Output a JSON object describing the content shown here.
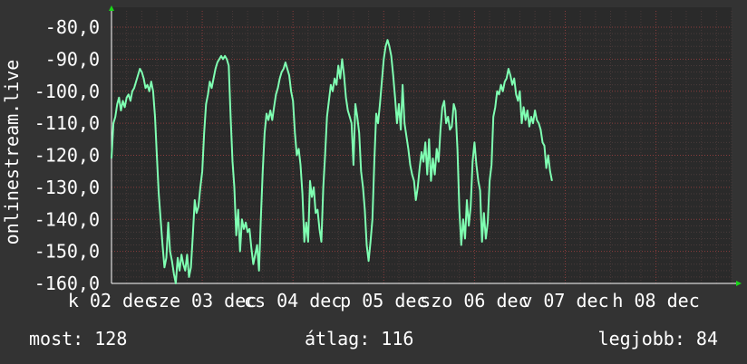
{
  "chart_data": {
    "type": "line",
    "ylabel": "onlinestream.live",
    "ylim": [
      -160,
      -80
    ],
    "yticks": [
      "-80,0",
      "-90,0",
      "-100,0",
      "-110,0",
      "-120,0",
      "-130,0",
      "-140,0",
      "-150,0",
      "-160,0"
    ],
    "x_range_hours": [
      0,
      164
    ],
    "xticks": [
      {
        "label": "k 02 dec",
        "x": 0
      },
      {
        "label": "sze 03 dec",
        "x": 24
      },
      {
        "label": "cs 04 dec",
        "x": 48
      },
      {
        "label": "p 05 dec",
        "x": 72
      },
      {
        "label": "szo 06 dec",
        "x": 96
      },
      {
        "label": "v 07 dec",
        "x": 120
      },
      {
        "label": "h 08 dec",
        "x": 144
      }
    ],
    "grid": true,
    "line_color": "#7fffb2",
    "series": [
      {
        "values": [
          [
            0,
            -121
          ],
          [
            0.5,
            -110
          ],
          [
            1,
            -108
          ],
          [
            1.5,
            -104
          ],
          [
            2,
            -102
          ],
          [
            2.5,
            -106
          ],
          [
            3,
            -103
          ],
          [
            3.5,
            -105
          ],
          [
            4,
            -102
          ],
          [
            4.5,
            -101
          ],
          [
            5,
            -103
          ],
          [
            5.5,
            -100
          ],
          [
            6,
            -99
          ],
          [
            6.5,
            -97
          ],
          [
            7,
            -95
          ],
          [
            7.5,
            -93
          ],
          [
            8,
            -94
          ],
          [
            8.5,
            -96
          ],
          [
            9,
            -99
          ],
          [
            9.5,
            -98
          ],
          [
            10,
            -100
          ],
          [
            10.5,
            -97
          ],
          [
            11,
            -100
          ],
          [
            11.5,
            -108
          ],
          [
            12,
            -120
          ],
          [
            12.5,
            -132
          ],
          [
            13,
            -140
          ],
          [
            13.5,
            -148
          ],
          [
            14,
            -155
          ],
          [
            14.5,
            -152
          ],
          [
            15,
            -141
          ],
          [
            15.5,
            -150
          ],
          [
            16,
            -153
          ],
          [
            16.5,
            -157
          ],
          [
            17,
            -160
          ],
          [
            17.5,
            -152
          ],
          [
            18,
            -156
          ],
          [
            18.5,
            -151
          ],
          [
            19,
            -154
          ],
          [
            19.5,
            -156
          ],
          [
            20,
            -151
          ],
          [
            20.5,
            -158
          ],
          [
            21,
            -155
          ],
          [
            21.5,
            -145
          ],
          [
            22,
            -134
          ],
          [
            22.5,
            -138
          ],
          [
            23,
            -136
          ],
          [
            23.5,
            -130
          ],
          [
            24,
            -125
          ],
          [
            24.5,
            -113
          ],
          [
            25,
            -104
          ],
          [
            25.5,
            -101
          ],
          [
            26,
            -97
          ],
          [
            26.5,
            -99
          ],
          [
            27,
            -96
          ],
          [
            27.5,
            -93
          ],
          [
            28,
            -91
          ],
          [
            28.5,
            -90
          ],
          [
            29,
            -89
          ],
          [
            29.5,
            -90
          ],
          [
            30,
            -89
          ],
          [
            30.5,
            -90
          ],
          [
            31,
            -92
          ],
          [
            31.5,
            -108
          ],
          [
            32,
            -122
          ],
          [
            32.5,
            -130
          ],
          [
            33,
            -145
          ],
          [
            33.5,
            -137
          ],
          [
            34,
            -150
          ],
          [
            34.5,
            -140
          ],
          [
            35,
            -143
          ],
          [
            35.5,
            -141
          ],
          [
            36,
            -144
          ],
          [
            36.5,
            -143
          ],
          [
            37,
            -149
          ],
          [
            37.5,
            -154
          ],
          [
            38,
            -151
          ],
          [
            38.5,
            -148
          ],
          [
            39,
            -156
          ],
          [
            39.5,
            -140
          ],
          [
            40,
            -125
          ],
          [
            40.5,
            -113
          ],
          [
            41,
            -107
          ],
          [
            41.5,
            -109
          ],
          [
            42,
            -106
          ],
          [
            42.5,
            -109
          ],
          [
            43,
            -105
          ],
          [
            43.5,
            -101
          ],
          [
            44,
            -99
          ],
          [
            44.5,
            -96
          ],
          [
            45,
            -94
          ],
          [
            45.5,
            -93
          ],
          [
            46,
            -91
          ],
          [
            46.5,
            -93
          ],
          [
            47,
            -95
          ],
          [
            47.5,
            -100
          ],
          [
            48,
            -103
          ],
          [
            48.5,
            -113
          ],
          [
            49,
            -120
          ],
          [
            49.5,
            -118
          ],
          [
            50,
            -123
          ],
          [
            50.5,
            -132
          ],
          [
            51,
            -147
          ],
          [
            51.5,
            -141
          ],
          [
            52,
            -147
          ],
          [
            52.5,
            -128
          ],
          [
            53,
            -133
          ],
          [
            53.5,
            -130
          ],
          [
            54,
            -138
          ],
          [
            54.5,
            -137
          ],
          [
            55,
            -143
          ],
          [
            55.5,
            -147
          ],
          [
            56,
            -130
          ],
          [
            56.5,
            -120
          ],
          [
            57,
            -108
          ],
          [
            57.5,
            -103
          ],
          [
            58,
            -98
          ],
          [
            58.5,
            -100
          ],
          [
            59,
            -96
          ],
          [
            59.5,
            -98
          ],
          [
            60,
            -92
          ],
          [
            60.5,
            -96
          ],
          [
            61,
            -90
          ],
          [
            61.5,
            -95
          ],
          [
            62,
            -102
          ],
          [
            62.5,
            -106
          ],
          [
            63,
            -108
          ],
          [
            63.5,
            -110
          ],
          [
            64,
            -123
          ],
          [
            64.5,
            -104
          ],
          [
            65,
            -108
          ],
          [
            65.5,
            -113
          ],
          [
            66,
            -125
          ],
          [
            66.5,
            -130
          ],
          [
            67,
            -137
          ],
          [
            67.5,
            -148
          ],
          [
            68,
            -153
          ],
          [
            68.5,
            -147
          ],
          [
            69,
            -140
          ],
          [
            69.5,
            -122
          ],
          [
            70,
            -107
          ],
          [
            70.5,
            -110
          ],
          [
            71,
            -104
          ],
          [
            71.5,
            -97
          ],
          [
            72,
            -90
          ],
          [
            72.5,
            -86
          ],
          [
            73,
            -84
          ],
          [
            73.5,
            -86
          ],
          [
            74,
            -89
          ],
          [
            74.5,
            -95
          ],
          [
            75,
            -102
          ],
          [
            75.5,
            -110
          ],
          [
            76,
            -104
          ],
          [
            76.5,
            -112
          ],
          [
            77,
            -98
          ],
          [
            77.5,
            -110
          ],
          [
            78,
            -114
          ],
          [
            78.5,
            -118
          ],
          [
            79,
            -123
          ],
          [
            79.5,
            -126
          ],
          [
            80,
            -128
          ],
          [
            80.5,
            -134
          ],
          [
            81,
            -130
          ],
          [
            81.5,
            -124
          ],
          [
            82,
            -119
          ],
          [
            82.5,
            -122
          ],
          [
            83,
            -116
          ],
          [
            83.5,
            -126
          ],
          [
            84,
            -115
          ],
          [
            84.5,
            -128
          ],
          [
            85,
            -121
          ],
          [
            85.5,
            -126
          ],
          [
            86,
            -118
          ],
          [
            86.5,
            -122
          ],
          [
            87,
            -112
          ],
          [
            87.5,
            -105
          ],
          [
            88,
            -103
          ],
          [
            88.5,
            -110
          ],
          [
            89,
            -108
          ],
          [
            89.5,
            -112
          ],
          [
            90,
            -111
          ],
          [
            90.5,
            -104
          ],
          [
            91,
            -106
          ],
          [
            91.5,
            -118
          ],
          [
            92,
            -137
          ],
          [
            92.5,
            -148
          ],
          [
            93,
            -140
          ],
          [
            93.5,
            -146
          ],
          [
            94,
            -134
          ],
          [
            94.5,
            -142
          ],
          [
            95,
            -136
          ],
          [
            95.5,
            -122
          ],
          [
            96,
            -116
          ],
          [
            96.5,
            -123
          ],
          [
            97,
            -128
          ],
          [
            97.5,
            -131
          ],
          [
            98,
            -147
          ],
          [
            98.5,
            -138
          ],
          [
            99,
            -146
          ],
          [
            99.5,
            -141
          ],
          [
            100,
            -128
          ],
          [
            100.5,
            -123
          ],
          [
            101,
            -108
          ],
          [
            101.5,
            -105
          ],
          [
            102,
            -100
          ],
          [
            102.5,
            -101
          ],
          [
            103,
            -98
          ],
          [
            103.5,
            -100
          ],
          [
            104,
            -97
          ],
          [
            104.5,
            -96
          ],
          [
            105,
            -93
          ],
          [
            105.5,
            -95
          ],
          [
            106,
            -98
          ],
          [
            106.5,
            -96
          ],
          [
            107,
            -101
          ],
          [
            107.5,
            -103
          ],
          [
            108,
            -100
          ],
          [
            108.5,
            -110
          ],
          [
            109,
            -105
          ],
          [
            109.5,
            -109
          ],
          [
            110,
            -106
          ],
          [
            110.5,
            -111
          ],
          [
            111,
            -108
          ],
          [
            111.5,
            -110
          ],
          [
            112,
            -106
          ],
          [
            112.5,
            -109
          ],
          [
            113,
            -110
          ],
          [
            113.5,
            -112
          ],
          [
            114,
            -116
          ],
          [
            114.5,
            -117
          ],
          [
            115,
            -124
          ],
          [
            115.5,
            -120
          ],
          [
            116,
            -125
          ],
          [
            116.5,
            -128
          ]
        ]
      }
    ]
  },
  "stats": {
    "now": "most: 128",
    "avg": "átlag: 116",
    "best": "legjobb: 84"
  }
}
